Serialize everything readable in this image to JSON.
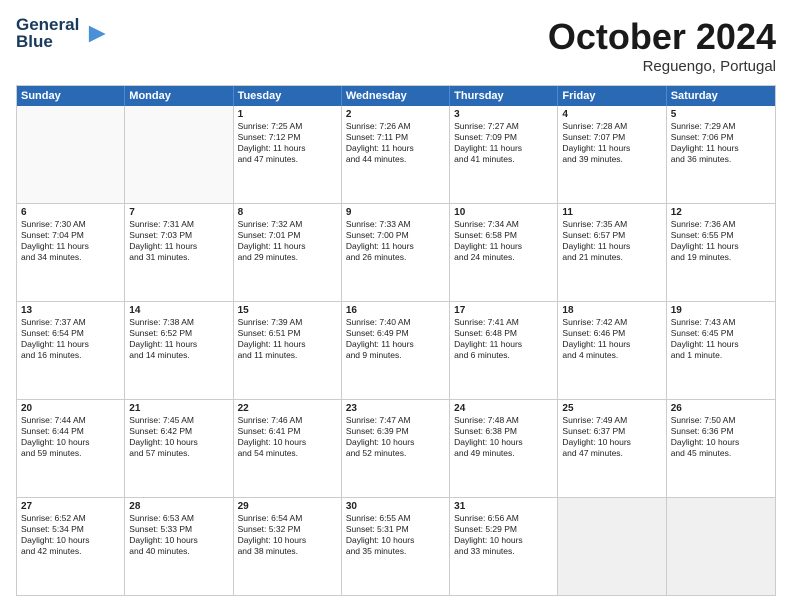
{
  "header": {
    "logo_line1": "General",
    "logo_line2": "Blue",
    "month": "October 2024",
    "location": "Reguengo, Portugal"
  },
  "weekdays": [
    "Sunday",
    "Monday",
    "Tuesday",
    "Wednesday",
    "Thursday",
    "Friday",
    "Saturday"
  ],
  "rows": [
    [
      {
        "day": "",
        "lines": [],
        "empty": true
      },
      {
        "day": "",
        "lines": [],
        "empty": true
      },
      {
        "day": "1",
        "lines": [
          "Sunrise: 7:25 AM",
          "Sunset: 7:12 PM",
          "Daylight: 11 hours",
          "and 47 minutes."
        ],
        "empty": false
      },
      {
        "day": "2",
        "lines": [
          "Sunrise: 7:26 AM",
          "Sunset: 7:11 PM",
          "Daylight: 11 hours",
          "and 44 minutes."
        ],
        "empty": false
      },
      {
        "day": "3",
        "lines": [
          "Sunrise: 7:27 AM",
          "Sunset: 7:09 PM",
          "Daylight: 11 hours",
          "and 41 minutes."
        ],
        "empty": false
      },
      {
        "day": "4",
        "lines": [
          "Sunrise: 7:28 AM",
          "Sunset: 7:07 PM",
          "Daylight: 11 hours",
          "and 39 minutes."
        ],
        "empty": false
      },
      {
        "day": "5",
        "lines": [
          "Sunrise: 7:29 AM",
          "Sunset: 7:06 PM",
          "Daylight: 11 hours",
          "and 36 minutes."
        ],
        "empty": false
      }
    ],
    [
      {
        "day": "6",
        "lines": [
          "Sunrise: 7:30 AM",
          "Sunset: 7:04 PM",
          "Daylight: 11 hours",
          "and 34 minutes."
        ],
        "empty": false
      },
      {
        "day": "7",
        "lines": [
          "Sunrise: 7:31 AM",
          "Sunset: 7:03 PM",
          "Daylight: 11 hours",
          "and 31 minutes."
        ],
        "empty": false
      },
      {
        "day": "8",
        "lines": [
          "Sunrise: 7:32 AM",
          "Sunset: 7:01 PM",
          "Daylight: 11 hours",
          "and 29 minutes."
        ],
        "empty": false
      },
      {
        "day": "9",
        "lines": [
          "Sunrise: 7:33 AM",
          "Sunset: 7:00 PM",
          "Daylight: 11 hours",
          "and 26 minutes."
        ],
        "empty": false
      },
      {
        "day": "10",
        "lines": [
          "Sunrise: 7:34 AM",
          "Sunset: 6:58 PM",
          "Daylight: 11 hours",
          "and 24 minutes."
        ],
        "empty": false
      },
      {
        "day": "11",
        "lines": [
          "Sunrise: 7:35 AM",
          "Sunset: 6:57 PM",
          "Daylight: 11 hours",
          "and 21 minutes."
        ],
        "empty": false
      },
      {
        "day": "12",
        "lines": [
          "Sunrise: 7:36 AM",
          "Sunset: 6:55 PM",
          "Daylight: 11 hours",
          "and 19 minutes."
        ],
        "empty": false
      }
    ],
    [
      {
        "day": "13",
        "lines": [
          "Sunrise: 7:37 AM",
          "Sunset: 6:54 PM",
          "Daylight: 11 hours",
          "and 16 minutes."
        ],
        "empty": false
      },
      {
        "day": "14",
        "lines": [
          "Sunrise: 7:38 AM",
          "Sunset: 6:52 PM",
          "Daylight: 11 hours",
          "and 14 minutes."
        ],
        "empty": false
      },
      {
        "day": "15",
        "lines": [
          "Sunrise: 7:39 AM",
          "Sunset: 6:51 PM",
          "Daylight: 11 hours",
          "and 11 minutes."
        ],
        "empty": false
      },
      {
        "day": "16",
        "lines": [
          "Sunrise: 7:40 AM",
          "Sunset: 6:49 PM",
          "Daylight: 11 hours",
          "and 9 minutes."
        ],
        "empty": false
      },
      {
        "day": "17",
        "lines": [
          "Sunrise: 7:41 AM",
          "Sunset: 6:48 PM",
          "Daylight: 11 hours",
          "and 6 minutes."
        ],
        "empty": false
      },
      {
        "day": "18",
        "lines": [
          "Sunrise: 7:42 AM",
          "Sunset: 6:46 PM",
          "Daylight: 11 hours",
          "and 4 minutes."
        ],
        "empty": false
      },
      {
        "day": "19",
        "lines": [
          "Sunrise: 7:43 AM",
          "Sunset: 6:45 PM",
          "Daylight: 11 hours",
          "and 1 minute."
        ],
        "empty": false
      }
    ],
    [
      {
        "day": "20",
        "lines": [
          "Sunrise: 7:44 AM",
          "Sunset: 6:44 PM",
          "Daylight: 10 hours",
          "and 59 minutes."
        ],
        "empty": false
      },
      {
        "day": "21",
        "lines": [
          "Sunrise: 7:45 AM",
          "Sunset: 6:42 PM",
          "Daylight: 10 hours",
          "and 57 minutes."
        ],
        "empty": false
      },
      {
        "day": "22",
        "lines": [
          "Sunrise: 7:46 AM",
          "Sunset: 6:41 PM",
          "Daylight: 10 hours",
          "and 54 minutes."
        ],
        "empty": false
      },
      {
        "day": "23",
        "lines": [
          "Sunrise: 7:47 AM",
          "Sunset: 6:39 PM",
          "Daylight: 10 hours",
          "and 52 minutes."
        ],
        "empty": false
      },
      {
        "day": "24",
        "lines": [
          "Sunrise: 7:48 AM",
          "Sunset: 6:38 PM",
          "Daylight: 10 hours",
          "and 49 minutes."
        ],
        "empty": false
      },
      {
        "day": "25",
        "lines": [
          "Sunrise: 7:49 AM",
          "Sunset: 6:37 PM",
          "Daylight: 10 hours",
          "and 47 minutes."
        ],
        "empty": false
      },
      {
        "day": "26",
        "lines": [
          "Sunrise: 7:50 AM",
          "Sunset: 6:36 PM",
          "Daylight: 10 hours",
          "and 45 minutes."
        ],
        "empty": false
      }
    ],
    [
      {
        "day": "27",
        "lines": [
          "Sunrise: 6:52 AM",
          "Sunset: 5:34 PM",
          "Daylight: 10 hours",
          "and 42 minutes."
        ],
        "empty": false
      },
      {
        "day": "28",
        "lines": [
          "Sunrise: 6:53 AM",
          "Sunset: 5:33 PM",
          "Daylight: 10 hours",
          "and 40 minutes."
        ],
        "empty": false
      },
      {
        "day": "29",
        "lines": [
          "Sunrise: 6:54 AM",
          "Sunset: 5:32 PM",
          "Daylight: 10 hours",
          "and 38 minutes."
        ],
        "empty": false
      },
      {
        "day": "30",
        "lines": [
          "Sunrise: 6:55 AM",
          "Sunset: 5:31 PM",
          "Daylight: 10 hours",
          "and 35 minutes."
        ],
        "empty": false
      },
      {
        "day": "31",
        "lines": [
          "Sunrise: 6:56 AM",
          "Sunset: 5:29 PM",
          "Daylight: 10 hours",
          "and 33 minutes."
        ],
        "empty": false
      },
      {
        "day": "",
        "lines": [],
        "empty": true,
        "shaded": true
      },
      {
        "day": "",
        "lines": [],
        "empty": true,
        "shaded": true
      }
    ]
  ]
}
